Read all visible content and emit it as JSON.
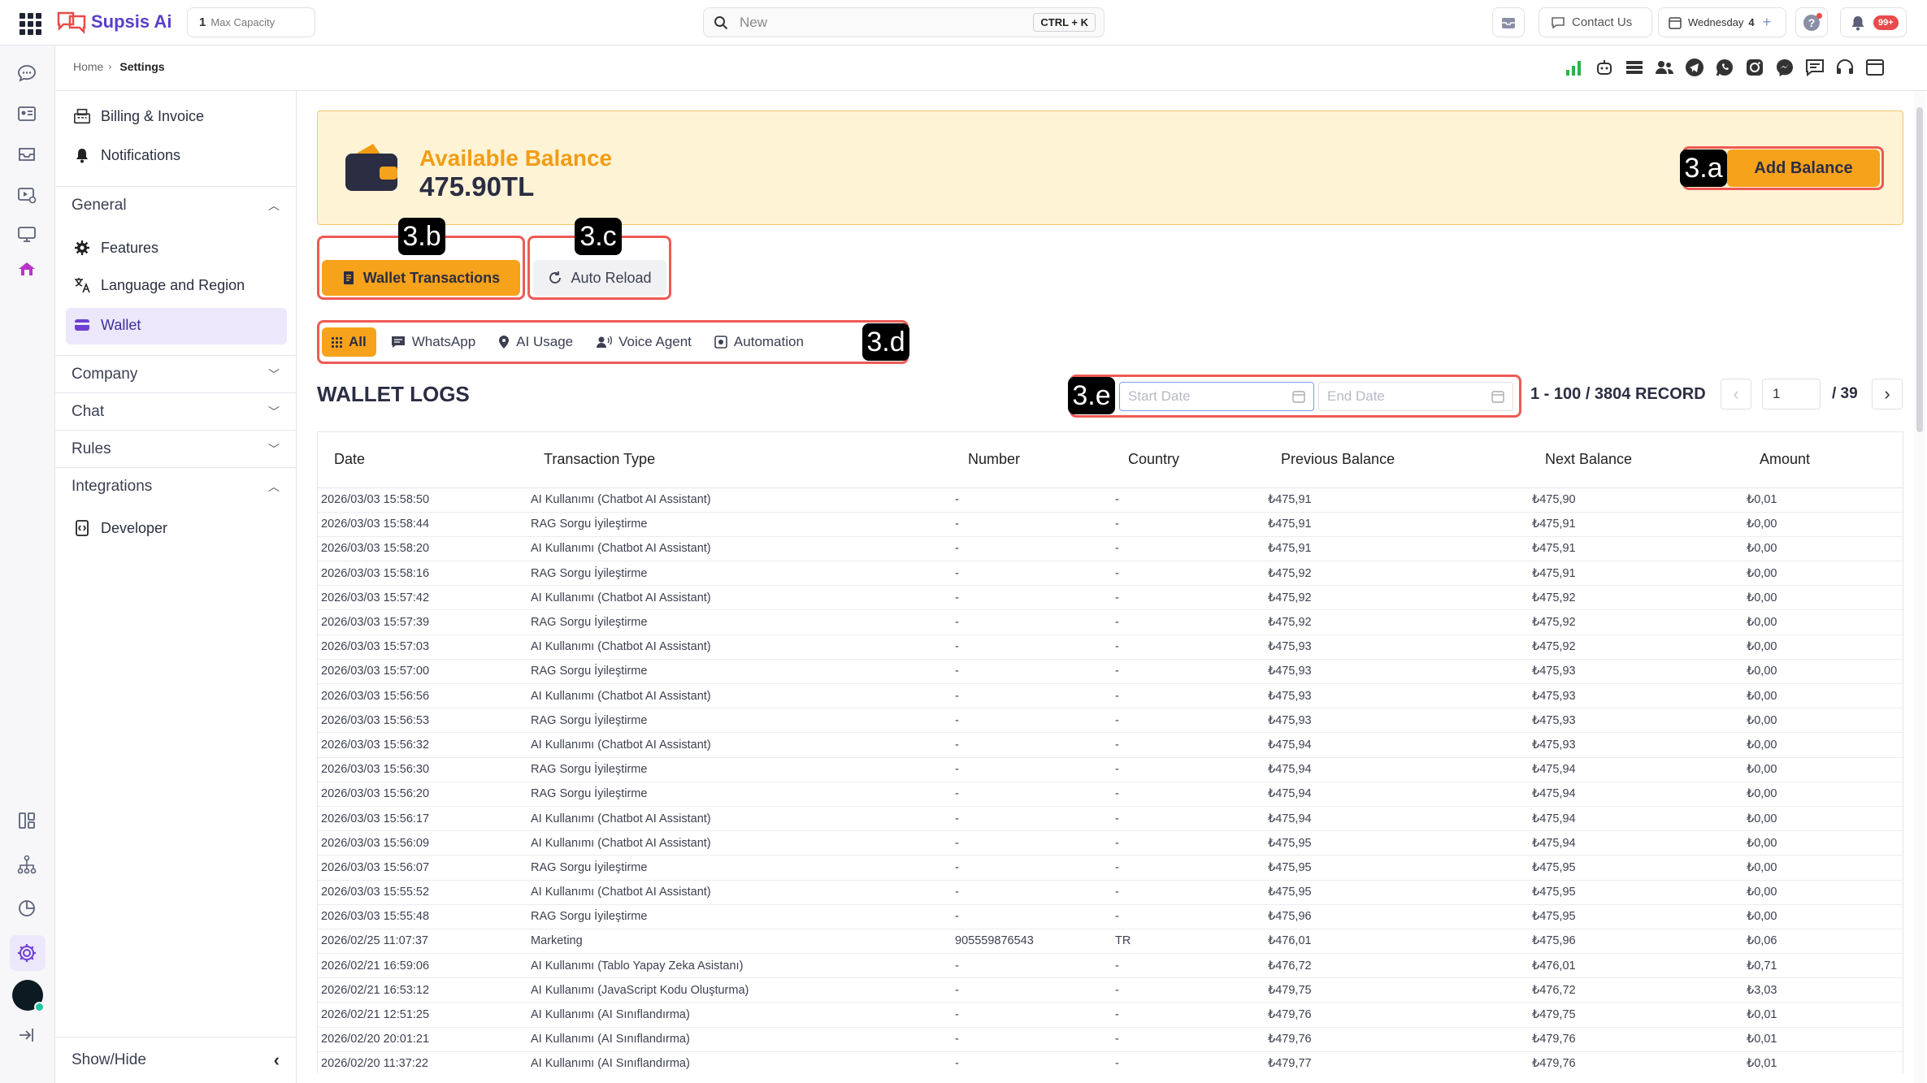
{
  "topbar": {
    "brand": "Supsis Ai",
    "capacity_count": "1",
    "capacity_label": "Max Capacity",
    "search_placeholder": "New",
    "search_shortcut": "CTRL + K",
    "contact_label": "Contact Us",
    "day_label": "Wednesday",
    "day_number": "4",
    "notification_badge": "99+"
  },
  "breadcrumb": {
    "home": "Home",
    "current": "Settings"
  },
  "sidebar": {
    "billing": "Billing & Invoice",
    "notifications": "Notifications",
    "general": "General",
    "features": "Features",
    "language": "Language and Region",
    "wallet": "Wallet",
    "company": "Company",
    "chat": "Chat",
    "rules": "Rules",
    "integrations": "Integrations",
    "developer": "Developer",
    "show_hide": "Show/Hide"
  },
  "balance": {
    "title": "Available Balance",
    "amount": "475.90TL",
    "add_button": "Add Balance"
  },
  "tabs": {
    "wallet_transactions": "Wallet Transactions",
    "auto_reload": "Auto Reload"
  },
  "filters": {
    "all": "All",
    "whatsapp": "WhatsApp",
    "ai_usage": "AI Usage",
    "voice_agent": "Voice Agent",
    "automation": "Automation"
  },
  "logs": {
    "title": "WALLET LOGS",
    "start_placeholder": "Start Date",
    "end_placeholder": "End Date",
    "record_text": "1 - 100 / 3804 RECORD",
    "page_value": "1",
    "page_total": "/ 39"
  },
  "annotations": {
    "a": "3.a",
    "b": "3.b",
    "c": "3.c",
    "d": "3.d",
    "e": "3.e"
  },
  "table": {
    "columns": [
      "Date",
      "Transaction Type",
      "Number",
      "Country",
      "Previous Balance",
      "Next Balance",
      "Amount"
    ],
    "rows": [
      [
        "2026/03/03 15:58:50",
        "AI Kullanımı (Chatbot AI Assistant)",
        "-",
        "-",
        "₺475,91",
        "₺475,90",
        "₺0,01"
      ],
      [
        "2026/03/03 15:58:44",
        "RAG Sorgu İyileştirme",
        "-",
        "-",
        "₺475,91",
        "₺475,91",
        "₺0,00"
      ],
      [
        "2026/03/03 15:58:20",
        "AI Kullanımı (Chatbot AI Assistant)",
        "-",
        "-",
        "₺475,91",
        "₺475,91",
        "₺0,00"
      ],
      [
        "2026/03/03 15:58:16",
        "RAG Sorgu İyileştirme",
        "-",
        "-",
        "₺475,92",
        "₺475,91",
        "₺0,00"
      ],
      [
        "2026/03/03 15:57:42",
        "AI Kullanımı (Chatbot AI Assistant)",
        "-",
        "-",
        "₺475,92",
        "₺475,92",
        "₺0,00"
      ],
      [
        "2026/03/03 15:57:39",
        "RAG Sorgu İyileştirme",
        "-",
        "-",
        "₺475,92",
        "₺475,92",
        "₺0,00"
      ],
      [
        "2026/03/03 15:57:03",
        "AI Kullanımı (Chatbot AI Assistant)",
        "-",
        "-",
        "₺475,93",
        "₺475,92",
        "₺0,00"
      ],
      [
        "2026/03/03 15:57:00",
        "RAG Sorgu İyileştirme",
        "-",
        "-",
        "₺475,93",
        "₺475,93",
        "₺0,00"
      ],
      [
        "2026/03/03 15:56:56",
        "AI Kullanımı (Chatbot AI Assistant)",
        "-",
        "-",
        "₺475,93",
        "₺475,93",
        "₺0,00"
      ],
      [
        "2026/03/03 15:56:53",
        "RAG Sorgu İyileştirme",
        "-",
        "-",
        "₺475,93",
        "₺475,93",
        "₺0,00"
      ],
      [
        "2026/03/03 15:56:32",
        "AI Kullanımı (Chatbot AI Assistant)",
        "-",
        "-",
        "₺475,94",
        "₺475,93",
        "₺0,00"
      ],
      [
        "2026/03/03 15:56:30",
        "RAG Sorgu İyileştirme",
        "-",
        "-",
        "₺475,94",
        "₺475,94",
        "₺0,00"
      ],
      [
        "2026/03/03 15:56:20",
        "RAG Sorgu İyileştirme",
        "-",
        "-",
        "₺475,94",
        "₺475,94",
        "₺0,00"
      ],
      [
        "2026/03/03 15:56:17",
        "AI Kullanımı (Chatbot AI Assistant)",
        "-",
        "-",
        "₺475,94",
        "₺475,94",
        "₺0,00"
      ],
      [
        "2026/03/03 15:56:09",
        "AI Kullanımı (Chatbot AI Assistant)",
        "-",
        "-",
        "₺475,95",
        "₺475,94",
        "₺0,00"
      ],
      [
        "2026/03/03 15:56:07",
        "RAG Sorgu İyileştirme",
        "-",
        "-",
        "₺475,95",
        "₺475,95",
        "₺0,00"
      ],
      [
        "2026/03/03 15:55:52",
        "AI Kullanımı (Chatbot AI Assistant)",
        "-",
        "-",
        "₺475,95",
        "₺475,95",
        "₺0,00"
      ],
      [
        "2026/03/03 15:55:48",
        "RAG Sorgu İyileştirme",
        "-",
        "-",
        "₺475,96",
        "₺475,95",
        "₺0,00"
      ],
      [
        "2026/02/25 11:07:37",
        "Marketing",
        "905559876543",
        "TR",
        "₺476,01",
        "₺475,96",
        "₺0,06"
      ],
      [
        "2026/02/21 16:59:06",
        "AI Kullanımı (Tablo Yapay Zeka Asistanı)",
        "-",
        "-",
        "₺476,72",
        "₺476,01",
        "₺0,71"
      ],
      [
        "2026/02/21 16:53:12",
        "AI Kullanımı (JavaScript Kodu Oluşturma)",
        "-",
        "-",
        "₺479,75",
        "₺476,72",
        "₺3,03"
      ],
      [
        "2026/02/21 12:51:25",
        "AI Kullanımı (AI Sınıflandırma)",
        "-",
        "-",
        "₺479,76",
        "₺479,75",
        "₺0,01"
      ],
      [
        "2026/02/20 20:01:21",
        "AI Kullanımı (AI Sınıflandırma)",
        "-",
        "-",
        "₺479,76",
        "₺479,76",
        "₺0,01"
      ],
      [
        "2026/02/20 11:37:22",
        "AI Kullanımı (AI Sınıflandırma)",
        "-",
        "-",
        "₺479,77",
        "₺479,76",
        "₺0,01"
      ]
    ]
  },
  "colors": {
    "accent": "#f7a21b",
    "accent_dark": "#f39c12",
    "balance_bg": "#fff3d6",
    "annotation": "#ee5a55",
    "wallet_active": "#ece7fb",
    "brand_purple": "#6d3fd3"
  }
}
